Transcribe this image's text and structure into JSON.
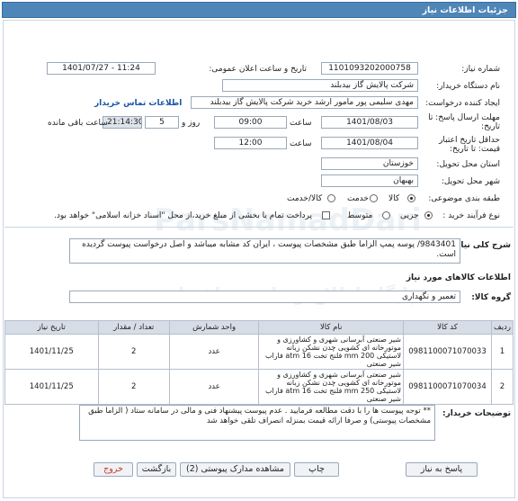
{
  "header": {
    "title": "جزئیات اطلاعات نیاز"
  },
  "form": {
    "need_number": {
      "label": "شماره نیاز:",
      "value": "1101093202000758"
    },
    "announce": {
      "label": "تاریخ و ساعت اعلان عمومی:",
      "value": "1401/07/27 - 11:24"
    },
    "buyer_org": {
      "label": "نام دستگاه خریدار:",
      "value": "شرکت پالایش گاز بیدبلند"
    },
    "requester": {
      "label": "ایجاد کننده درخواست:",
      "value": "مهدی سلیمی پور مامور ارشد خرید شرکت پالایش گاز بیدبلند",
      "contact_link": "اطلاعات تماس خریدار"
    },
    "reply_deadline": {
      "label": "مهلت ارسال پاسخ: تا تاریخ:",
      "date": "1401/08/03",
      "time_label": "ساعت",
      "time": "09:00",
      "days": "5",
      "days_label": "روز و",
      "remaining": "21:14:30",
      "remaining_label": "ساعت باقی مانده"
    },
    "price_validity": {
      "label": "حداقل تاریخ اعتبار قیمت: تا تاریخ:",
      "date": "1401/08/04",
      "time_label": "ساعت",
      "time": "12:00"
    },
    "province": {
      "label": "استان محل تحویل:",
      "value": "خوزستان"
    },
    "city": {
      "label": "شهر محل تحویل:",
      "value": "بهبهان"
    },
    "category": {
      "label": "طبقه بندی موضوعی:",
      "options": [
        "کالا",
        "خدمت",
        "کالا/خدمت"
      ],
      "selected": "کالا"
    },
    "process": {
      "label": "نوع فرآیند خرید :",
      "options": [
        "جزیی",
        "متوسط"
      ],
      "selected": "جزیی",
      "payment_note": "پرداخت تمام یا بخشی از مبلغ خرید،از محل \"اسناد خزانه اسلامی\" خواهد بود."
    }
  },
  "description": {
    "label": "شرح کلی نیاز:",
    "text": "9843401/ پوسه پمپ الزاما طبق مشخصات پیوست ، ایران کد مشابه میباشد و اصل درخواست پیوست گردیده است."
  },
  "goods": {
    "section_title": "اطلاعات کالاهای مورد نیاز",
    "group_label": "گروه کالا:",
    "group_value": "تعمیر و نگهداری",
    "columns": [
      "ردیف",
      "کد کالا",
      "نام کالا",
      "واحد شمارش",
      "تعداد / مقدار",
      "تاریخ نیاز"
    ],
    "rows": [
      {
        "row": "1",
        "code": "0981100071070033",
        "name": "شیر صنعتی آبرسانی شهری و کشاورزی و موتورخانه ای کشویی چدن نشکن زبانه لاستیکی mm 200 فلنج تخت 16 atm فاراب شیر صنعتی",
        "unit": "عدد",
        "qty": "2",
        "date": "1401/11/25"
      },
      {
        "row": "2",
        "code": "0981100071070034",
        "name": "شیر صنعتی آبرسانی شهری و کشاورزی و موتورخانه ای کشویی چدن نشکن زبانه لاستیکی mm 250 فلنج تخت 16 atm فاراب شیر صنعتی",
        "unit": "عدد",
        "qty": "2",
        "date": "1401/11/25"
      }
    ]
  },
  "buyer_notes": {
    "label": "توضیحات خریدار:",
    "text": "** توجه پیوست ها را با دقت مطالعه فرمایید . عدم پیوست پیشنهاد فنی و مالی در سامانه ستاد ( الزاما طبق مشخصات پیوستی) و صرفا ارائه قیمت بمنزله انصراف تلقی خواهد شد"
  },
  "buttons": {
    "reply": "پاسخ به نیاز",
    "print": "چاپ",
    "attachments": "مشاهده مدارک پیوستی (2)",
    "back": "بازگشت",
    "exit": "خروج"
  },
  "watermark": {
    "line1": "ParsNamadDari",
    "line2": "پایگاه اطلاع رسانی مناقصات"
  }
}
